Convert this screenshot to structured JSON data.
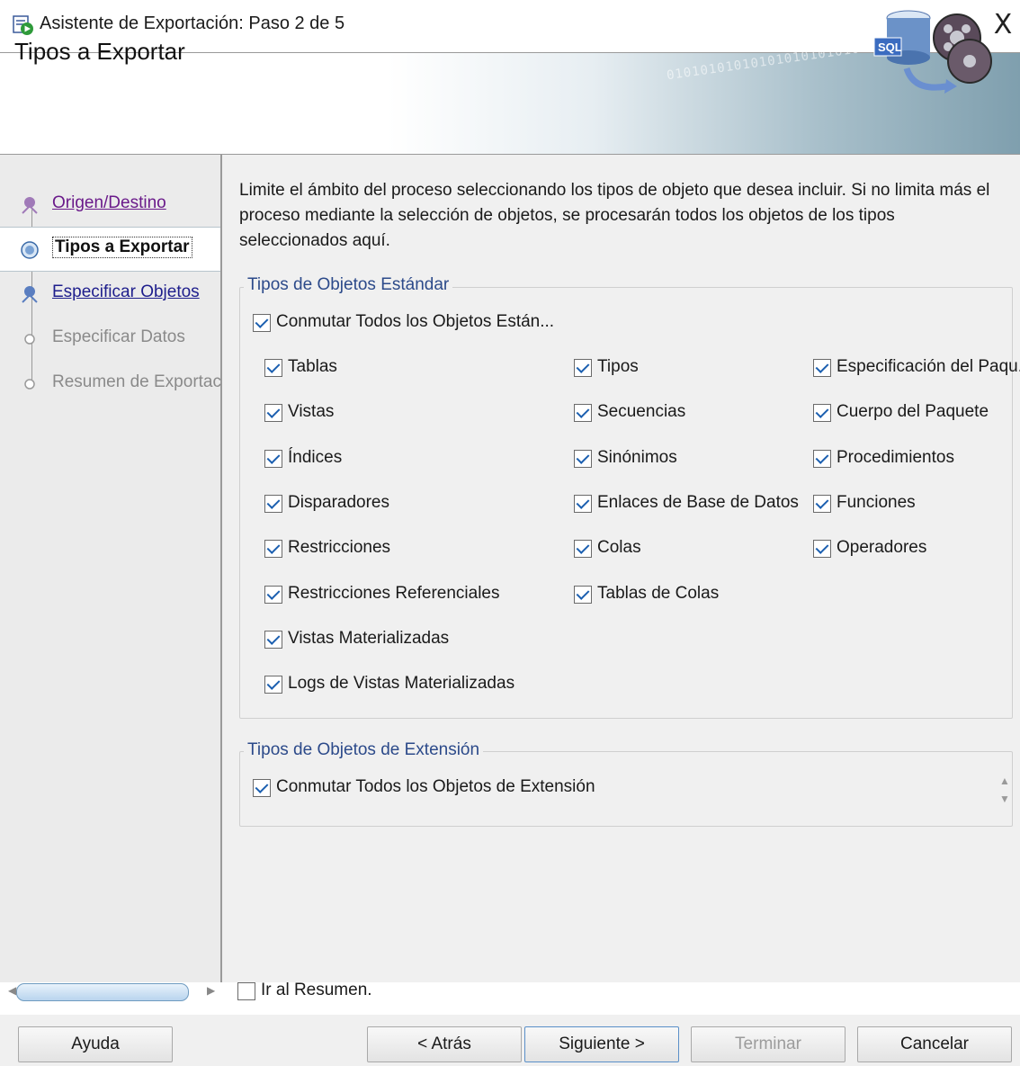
{
  "window": {
    "title": "Asistente de Exportación: Paso 2 de 5",
    "close_glyph": "X",
    "app_icon": "wizard-icon"
  },
  "banner": {
    "title": "Tipos a Exportar",
    "binary_text": "0101010101010101010101010101",
    "graphic": "sql-database-export-icon"
  },
  "nav": {
    "items": [
      {
        "label": "Origen/Destino",
        "state": "visited"
      },
      {
        "label": "Tipos a Exportar",
        "state": "current"
      },
      {
        "label": "Especificar Objetos",
        "state": "link"
      },
      {
        "label": "Especificar Datos",
        "state": "disabled"
      },
      {
        "label": "Resumen de Exportación",
        "state": "disabled"
      }
    ]
  },
  "intro": "Limite el ámbito del proceso seleccionando los tipos de objeto que desea incluir. Si no limita más el proceso mediante la selección de objetos, se procesarán todos los objetos de los tipos seleccionados aquí.",
  "standard": {
    "title": "Tipos de Objetos Estándar",
    "toggle_all": {
      "label": "Conmutar Todos los Objetos Están...",
      "checked": true
    },
    "col1": [
      {
        "label": "Tablas",
        "checked": true
      },
      {
        "label": "Vistas",
        "checked": true
      },
      {
        "label": "Índices",
        "checked": true
      },
      {
        "label": "Disparadores",
        "checked": true
      },
      {
        "label": "Restricciones",
        "checked": true
      },
      {
        "label": "Restricciones Referenciales",
        "checked": true
      },
      {
        "label": "Vistas Materializadas",
        "checked": true
      },
      {
        "label": "Logs de Vistas Materializadas",
        "checked": true
      }
    ],
    "col2": [
      {
        "label": "Tipos",
        "checked": true
      },
      {
        "label": "Secuencias",
        "checked": true
      },
      {
        "label": "Sinónimos",
        "checked": true
      },
      {
        "label": "Enlaces de Base de Datos",
        "checked": true
      },
      {
        "label": "Colas",
        "checked": true
      },
      {
        "label": "Tablas de Colas",
        "checked": true
      }
    ],
    "col3": [
      {
        "label": "Especificación del Paqu...",
        "checked": true
      },
      {
        "label": "Cuerpo del Paquete",
        "checked": true
      },
      {
        "label": "Procedimientos",
        "checked": true
      },
      {
        "label": "Funciones",
        "checked": true
      },
      {
        "label": "Operadores",
        "checked": true
      }
    ]
  },
  "extension": {
    "title": "Tipos de Objetos de Extensión",
    "toggle_all": {
      "label": "Conmutar Todos los Objetos de Extensión",
      "checked": true
    }
  },
  "goto_summary": {
    "label": "Ir al Resumen.",
    "checked": false
  },
  "buttons": {
    "help": "Ayuda",
    "back": "< Atrás",
    "next": "Siguiente >",
    "finish": "Terminar",
    "cancel": "Cancelar"
  },
  "colors": {
    "link": "#1e1e8c",
    "visited": "#6a1a8a",
    "group_title": "#2c4a8a",
    "check": "#1b5fb0"
  }
}
